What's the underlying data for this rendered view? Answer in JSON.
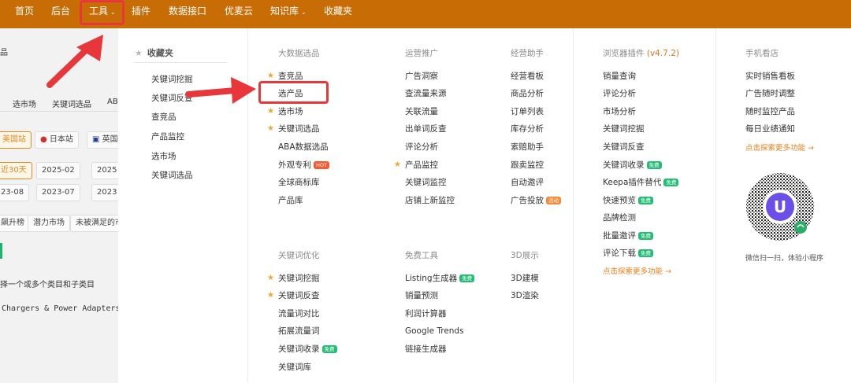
{
  "nav": {
    "items": [
      {
        "label": "首页"
      },
      {
        "label": "后台"
      },
      {
        "label": "工具",
        "caret": "⌄"
      },
      {
        "label": "插件"
      },
      {
        "label": "数据接口"
      },
      {
        "label": "优麦云"
      },
      {
        "label": "知识库",
        "caret": "⌄"
      },
      {
        "label": "收藏夹"
      }
    ]
  },
  "background": {
    "frag_top": "品",
    "tabs": [
      "选市场",
      "关键词选品",
      "AB"
    ],
    "sites": [
      "美国站",
      "日本站",
      "英国"
    ],
    "dates_row1": [
      "近30天",
      "2025-02",
      "2025"
    ],
    "dates_row2": [
      "23-08",
      "2023-07",
      "2023"
    ],
    "filters": [
      "飙升榜",
      "潜力市场",
      "未被满足的市"
    ],
    "hint": "择一个或多个类目和子类目",
    "category": "Chargers & Power Adapters (充"
  },
  "favorites": {
    "title": "收藏夹",
    "items": [
      "关键词挖掘",
      "关键词反查",
      "查竞品",
      "产品监控",
      "选市场",
      "关键词选品"
    ]
  },
  "sections": {
    "bigdata": {
      "title": "大数据选品",
      "items": [
        {
          "label": "查竞品",
          "star": true
        },
        {
          "label": "选产品"
        },
        {
          "label": "选市场",
          "star": true
        },
        {
          "label": "关键词选品",
          "star": true
        },
        {
          "label": "ABA数据选品"
        },
        {
          "label": "外观专利",
          "badge": "HOT"
        },
        {
          "label": "全球商标库"
        },
        {
          "label": "产品库"
        }
      ]
    },
    "ops": {
      "title": "运营推广",
      "items": [
        {
          "label": "广告洞察"
        },
        {
          "label": "查流量来源"
        },
        {
          "label": "关联流量"
        },
        {
          "label": "出单词反查"
        },
        {
          "label": "评论分析"
        },
        {
          "label": "产品监控",
          "star": true
        },
        {
          "label": "关键词监控"
        },
        {
          "label": "店铺上新监控"
        }
      ]
    },
    "biz": {
      "title": "经营助手",
      "items": [
        {
          "label": "经营看板"
        },
        {
          "label": "商品分析"
        },
        {
          "label": "订单列表"
        },
        {
          "label": "库存分析"
        },
        {
          "label": "索赔助手"
        },
        {
          "label": "跟卖监控"
        },
        {
          "label": "自动邀评"
        },
        {
          "label": "广告投放",
          "badge": "活动"
        }
      ]
    },
    "plugin": {
      "title": "浏览器插件",
      "version": "(v4.7.2)",
      "items": [
        {
          "label": "销量查询"
        },
        {
          "label": "评论分析"
        },
        {
          "label": "市场分析"
        },
        {
          "label": "关键词挖掘"
        },
        {
          "label": "关键词反查"
        },
        {
          "label": "关键词收录",
          "badge": "免费"
        },
        {
          "label": "Keepa插件替代",
          "badge": "免费"
        },
        {
          "label": "快速预览",
          "badge": "免费"
        },
        {
          "label": "品牌检测"
        },
        {
          "label": "批量邀评",
          "badge": "免费"
        },
        {
          "label": "评论下载",
          "badge": "免费"
        }
      ],
      "more": "点击探索更多功能 →"
    },
    "mobile": {
      "title": "手机看店",
      "items": [
        {
          "label": "实时销售看板"
        },
        {
          "label": "广告随时调整"
        },
        {
          "label": "随时监控产品"
        },
        {
          "label": "每日业绩通知"
        }
      ],
      "more": "点击探索更多功能 →",
      "qr_caption": "微信扫一扫，体验小程序"
    },
    "kw": {
      "title": "关键词优化",
      "items": [
        {
          "label": "关键词挖掘",
          "star": true
        },
        {
          "label": "关键词反查",
          "star": true
        },
        {
          "label": "流量词对比"
        },
        {
          "label": "拓展流量词"
        },
        {
          "label": "关键词收录",
          "badge": "免费"
        },
        {
          "label": "关键词库"
        }
      ]
    },
    "freetools": {
      "title": "免费工具",
      "items": [
        {
          "label": "Listing生成器",
          "badge": "免费"
        },
        {
          "label": "销量预测"
        },
        {
          "label": "利润计算器"
        },
        {
          "label": "Google Trends"
        },
        {
          "label": "链接生成器"
        }
      ]
    },
    "d3": {
      "title": "3D展示",
      "items": [
        {
          "label": "3D建模"
        },
        {
          "label": "3D渲染"
        }
      ]
    }
  },
  "colors": {
    "nav_bg": "#c86d06",
    "accent": "#f07c15",
    "star": "#f3a531",
    "annotation": "#e8373a",
    "free_badge": "#23bd74"
  }
}
